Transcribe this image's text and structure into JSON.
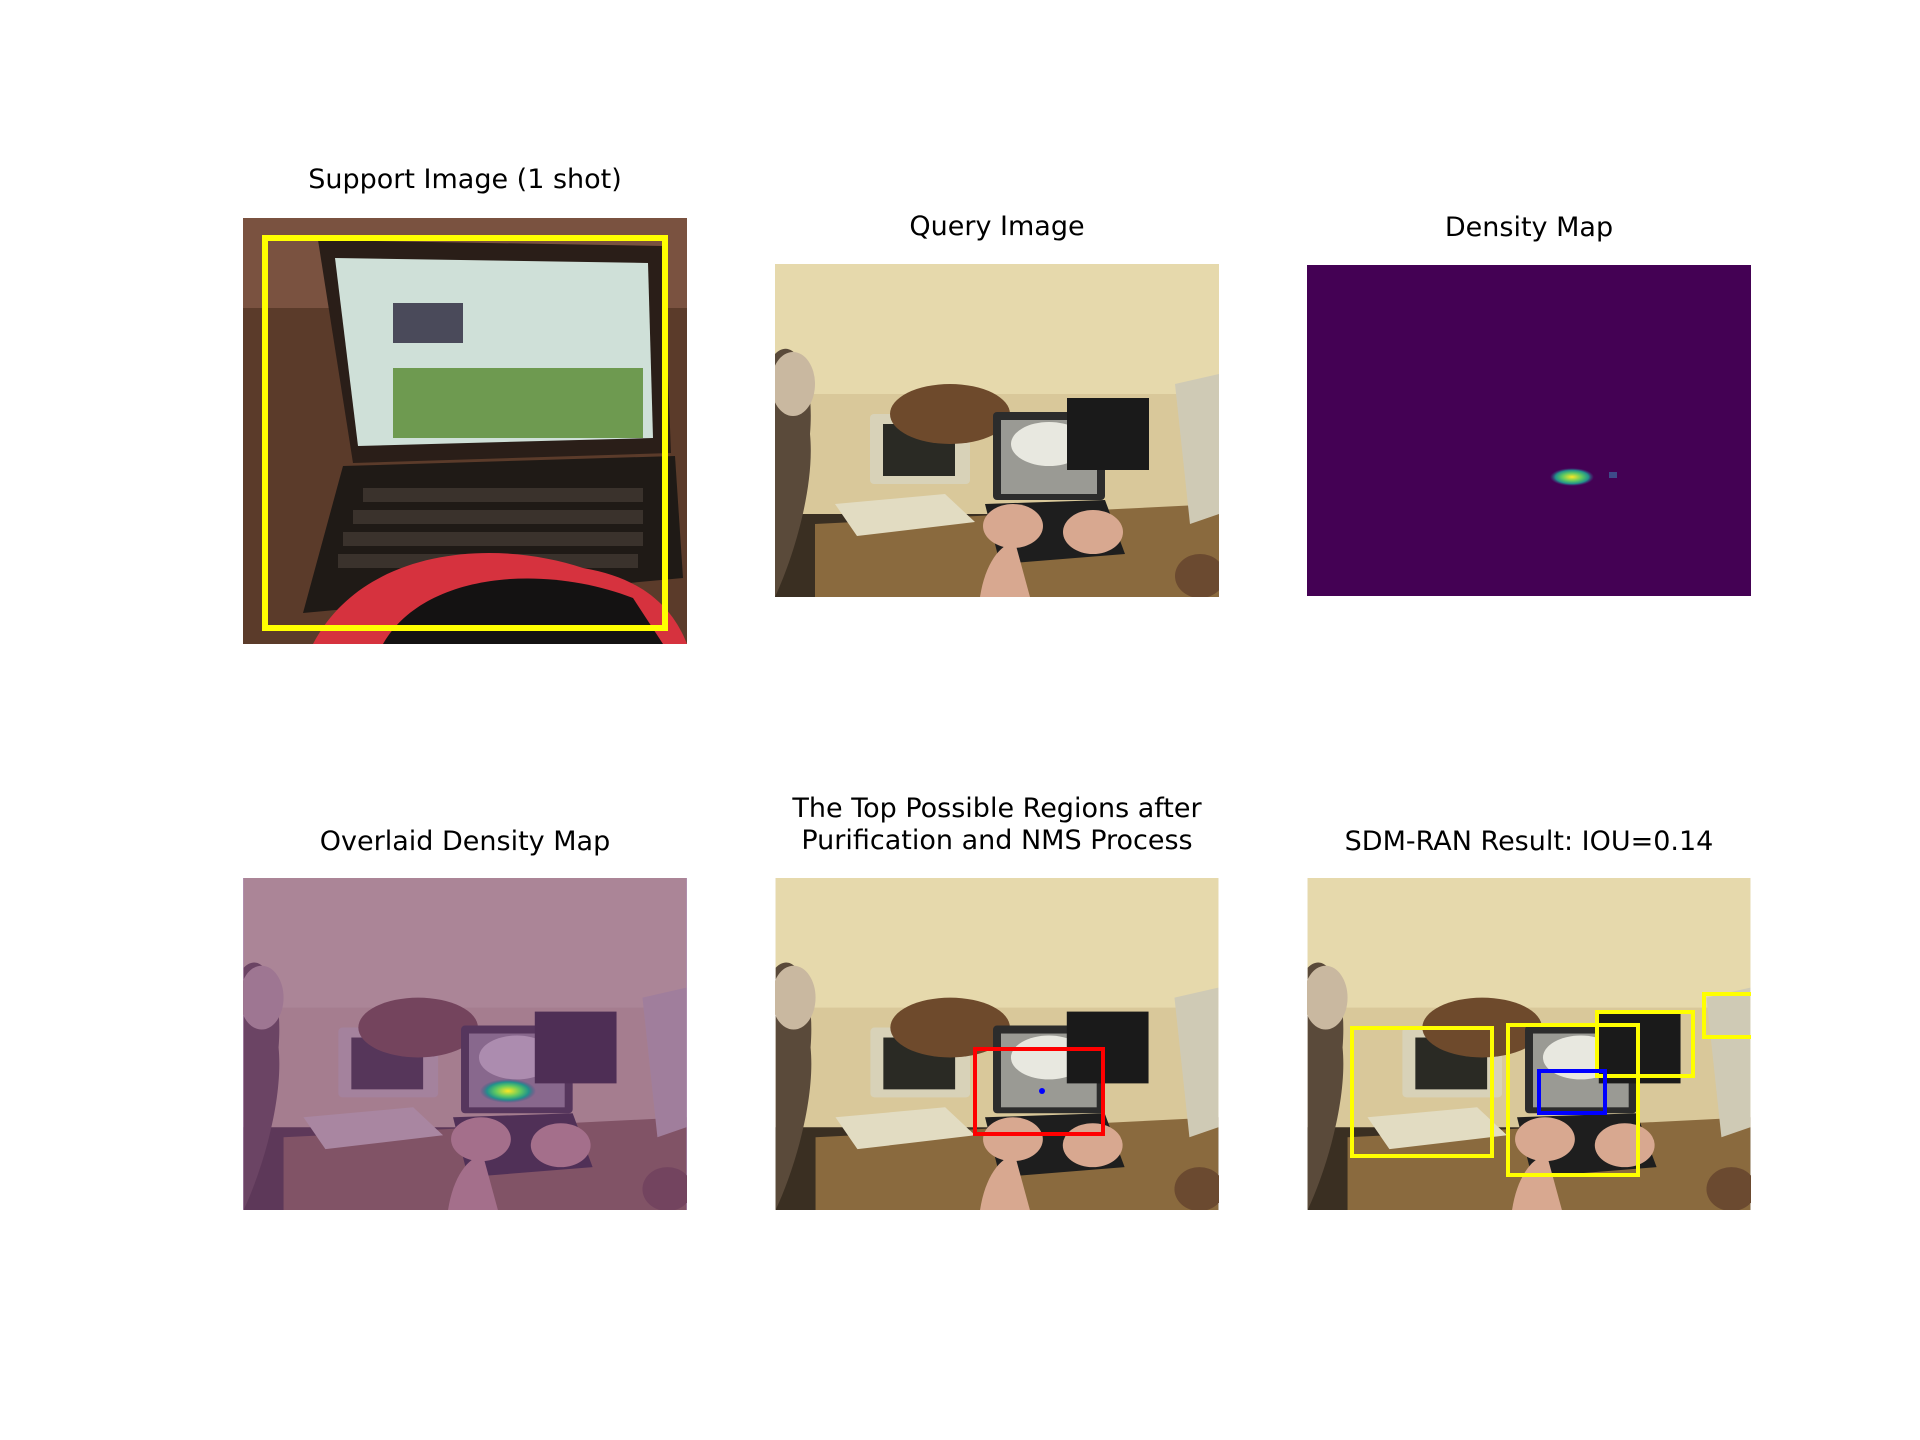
{
  "figure": {
    "panels": [
      {
        "id": "support",
        "title": "Support Image (1 shot)",
        "subject": "laptop"
      },
      {
        "id": "query",
        "title": "Query Image",
        "subject": "people working at laptops"
      },
      {
        "id": "density",
        "title": "Density Map",
        "colormap": "viridis"
      },
      {
        "id": "overlay",
        "title": "Overlaid Density Map"
      },
      {
        "id": "regions",
        "title_line1": "The Top Possible Regions after",
        "title_line2": "Purification and NMS Process"
      },
      {
        "id": "result",
        "title": "SDM-RAN Result: IOU=0.14"
      }
    ]
  },
  "colors": {
    "box_yellow": "#ffff00",
    "box_red": "#ff0000",
    "box_blue": "#0000ff",
    "density_bg": "#440154",
    "overlay_tint": "#8a5a96"
  }
}
